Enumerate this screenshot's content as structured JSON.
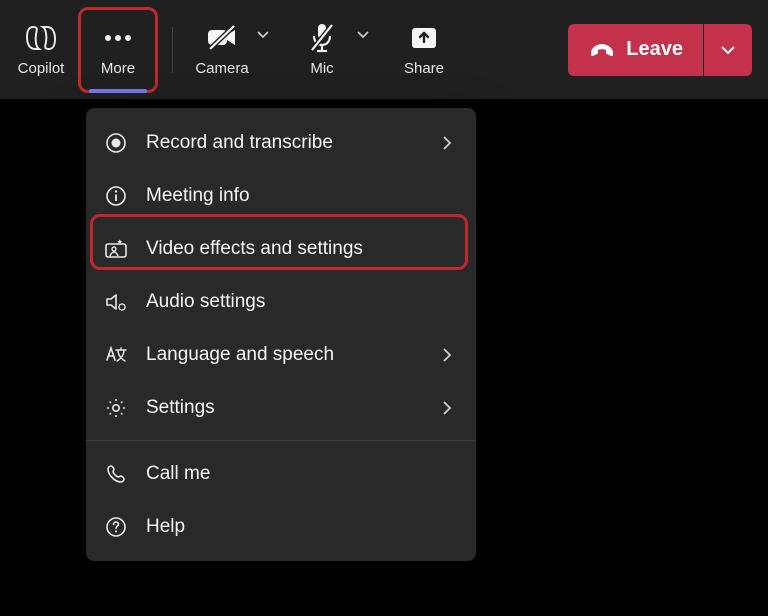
{
  "toolbar": {
    "copilot": "Copilot",
    "more": "More",
    "camera": "Camera",
    "mic": "Mic",
    "share": "Share",
    "leave": "Leave"
  },
  "menu": {
    "record": "Record and transcribe",
    "meeting_info": "Meeting info",
    "video_effects": "Video effects and settings",
    "audio_settings": "Audio settings",
    "language_speech": "Language and speech",
    "settings": "Settings",
    "call_me": "Call me",
    "help": "Help"
  }
}
